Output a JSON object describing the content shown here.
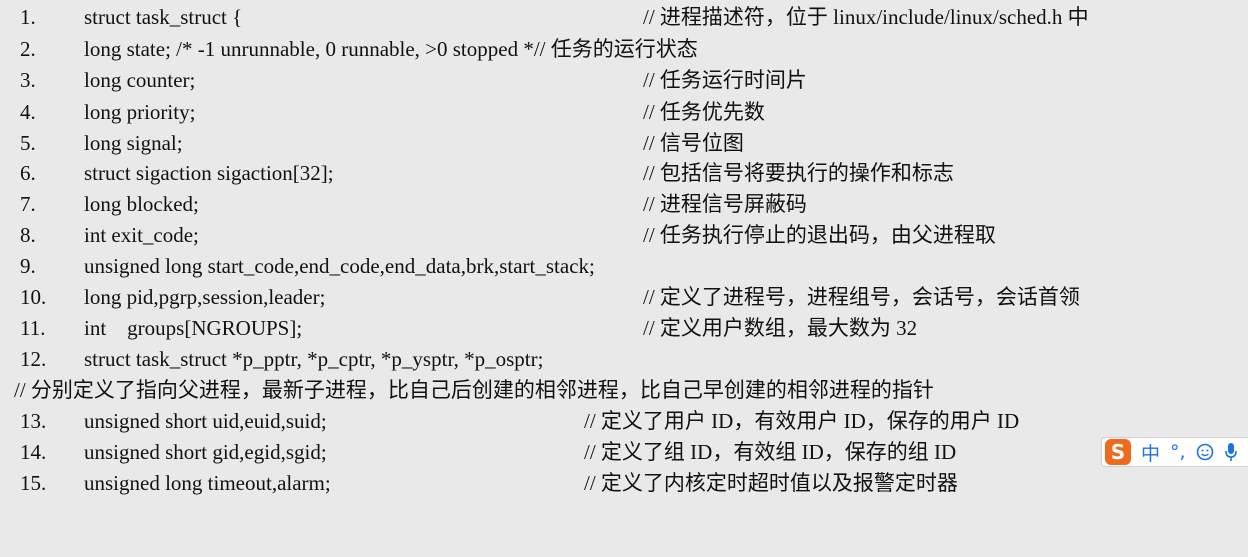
{
  "lines": [
    {
      "num": "1.",
      "code": "struct task_struct {",
      "comment": "// 进程描述符，位于 linux/include/linux/sched.h 中"
    },
    {
      "num": "2.",
      "code": "long state;  /* -1 unrunnable, 0 runnable, >0 stopped *//  任务的运行状态",
      "comment": ""
    },
    {
      "num": "3.",
      "code": "long counter;",
      "comment": "// 任务运行时间片"
    },
    {
      "num": "4.",
      "code": "long priority;",
      "comment": "// 任务优先数"
    },
    {
      "num": "5.",
      "code": "long signal;",
      "comment": "// 信号位图"
    },
    {
      "num": "6.",
      "code": "struct sigaction sigaction[32];",
      "comment": "// 包括信号将要执行的操作和标志"
    },
    {
      "num": "7.",
      "code": "long blocked;",
      "comment": "// 进程信号屏蔽码"
    },
    {
      "num": "8.",
      "code": "int exit_code;",
      "comment": "// 任务执行停止的退出码，由父进程取"
    },
    {
      "num": "9.",
      "code": "unsigned long start_code,end_code,end_data,brk,start_stack;",
      "comment": ""
    },
    {
      "num": "10.",
      "code": "long pid,pgrp,session,leader;",
      "comment": "// 定义了进程号，进程组号，会话号，会话首领"
    },
    {
      "num": "11.",
      "code": "int    groups[NGROUPS];",
      "comment": "// 定义用户数组，最大数为 32"
    },
    {
      "num": "12.",
      "code": "struct task_struct *p_pptr, *p_cptr, *p_ysptr, *p_osptr;",
      "comment": ""
    },
    {
      "num": "",
      "code": "",
      "comment": "// 分别定义了指向父进程，最新子进程，比自己后创建的相邻进程，比自己早创建的相邻进程的指针"
    },
    {
      "num": "13.",
      "code": "unsigned short uid,euid,suid;",
      "comment": "// 定义了用户 ID，有效用户 ID，保存的用户 ID"
    },
    {
      "num": "14.",
      "code": "unsigned short gid,egid,sgid;",
      "comment": "// 定义了组 ID，有效组 ID，保存的组 ID"
    },
    {
      "num": "15.",
      "code": "unsigned long timeout,alarm;",
      "comment": "// 定义了内核定时超时值以及报警定时器"
    }
  ],
  "ime": {
    "logo": "S",
    "mode": "中",
    "punct": "°,",
    "emoji_icon": "smiley-icon",
    "mic_icon": "microphone-icon"
  }
}
